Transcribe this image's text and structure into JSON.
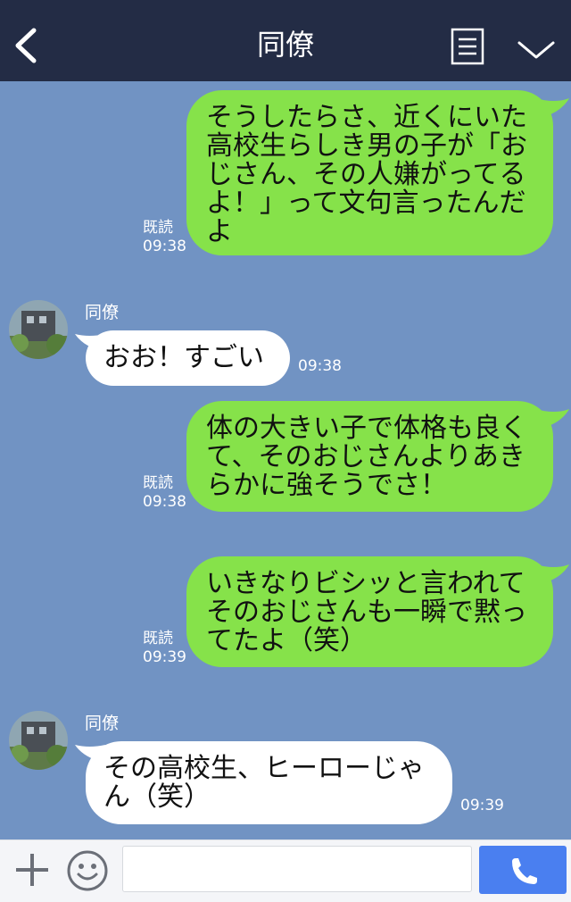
{
  "header": {
    "title": "同僚",
    "back_icon": "chevron-left-icon",
    "menu_icon": "menu-list-icon",
    "collapse_icon": "chevron-down-icon"
  },
  "messages": [
    {
      "direction": "sent",
      "lines": [
        "そうしたらさ、近くにいた",
        "高校生らしき男の子が「お",
        "じさん、その人嫌がってる",
        "よ！」って文句言ったんだ",
        "よ"
      ],
      "read": "既読",
      "time": "09:38"
    },
    {
      "direction": "received",
      "sender": "同僚",
      "lines": [
        "おお！すごい"
      ],
      "time": "09:38"
    },
    {
      "direction": "sent",
      "lines": [
        "体の大きい子で体格も良く",
        "て、そのおじさんよりあき",
        "らかに強そうでさ！"
      ],
      "read": "既読",
      "time": "09:38"
    },
    {
      "direction": "sent",
      "lines": [
        "いきなりビシッと言われて",
        "そのおじさんも一瞬で黙っ",
        "てたよ（笑）"
      ],
      "read": "既読",
      "time": "09:39"
    },
    {
      "direction": "received",
      "sender": "同僚",
      "lines": [
        "その高校生、ヒーローじゃ",
        "ん（笑）"
      ],
      "time": "09:39"
    }
  ],
  "input_bar": {
    "plus_icon": "plus-icon",
    "emoji_icon": "emoji-icon",
    "message_placeholder": "",
    "call_icon": "phone-icon"
  },
  "colors": {
    "header_bg": "#232c45",
    "chat_bg": "#7193c3",
    "sent_bubble": "#86e24a",
    "received_bubble": "#ffffff",
    "call_button": "#4a7ff0"
  }
}
